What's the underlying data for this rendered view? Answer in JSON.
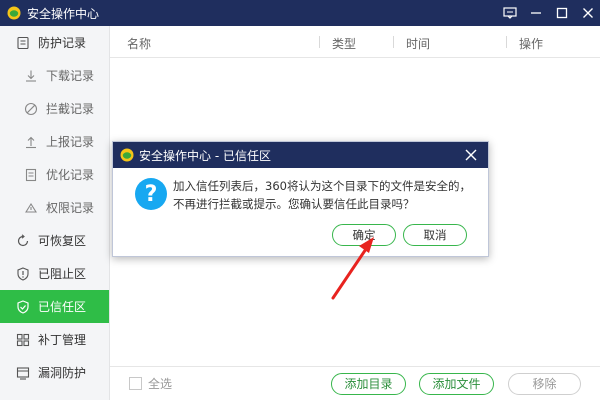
{
  "window": {
    "title": "安全操作中心",
    "controls": [
      "feedback-icon",
      "minimize-icon",
      "maximize-icon",
      "close-icon"
    ]
  },
  "sidebar": {
    "items": [
      {
        "label": "防护记录",
        "icon": "shield-record-icon",
        "level": 0,
        "active": false
      },
      {
        "label": "下载记录",
        "icon": "download-icon",
        "level": 1,
        "active": false
      },
      {
        "label": "拦截记录",
        "icon": "block-icon",
        "level": 1,
        "active": false
      },
      {
        "label": "上报记录",
        "icon": "upload-icon",
        "level": 1,
        "active": false
      },
      {
        "label": "优化记录",
        "icon": "document-icon",
        "level": 1,
        "active": false
      },
      {
        "label": "权限记录",
        "icon": "permission-icon",
        "level": 1,
        "active": false
      },
      {
        "label": "可恢复区",
        "icon": "restore-icon",
        "level": 0,
        "active": false
      },
      {
        "label": "已阻止区",
        "icon": "shield-alert-icon",
        "level": 0,
        "active": false
      },
      {
        "label": "已信任区",
        "icon": "shield-check-icon",
        "level": 0,
        "active": true
      },
      {
        "label": "补丁管理",
        "icon": "patch-icon",
        "level": 0,
        "active": false
      },
      {
        "label": "漏洞防护",
        "icon": "bug-shield-icon",
        "level": 0,
        "active": false
      }
    ],
    "active_color": "#2fbd47"
  },
  "table": {
    "headers": [
      "名称",
      "类型",
      "时间",
      "操作"
    ]
  },
  "footer": {
    "select_all": "全选",
    "add_dir": "添加目录",
    "add_file": "添加文件",
    "remove": "移除"
  },
  "dialog": {
    "title": "安全操作中心 - 已信任区",
    "message": "加入信任列表后，360将认为这个目录下的文件是安全的，不再进行拦截或提示。您确认要信任此目录吗？",
    "confirm": "确定",
    "cancel": "取消"
  },
  "colors": {
    "titlebar": "#1f2e5e",
    "accent_green": "#2fbd47",
    "question_blue": "#17a8f1",
    "annotation_red": "#e8231f"
  }
}
